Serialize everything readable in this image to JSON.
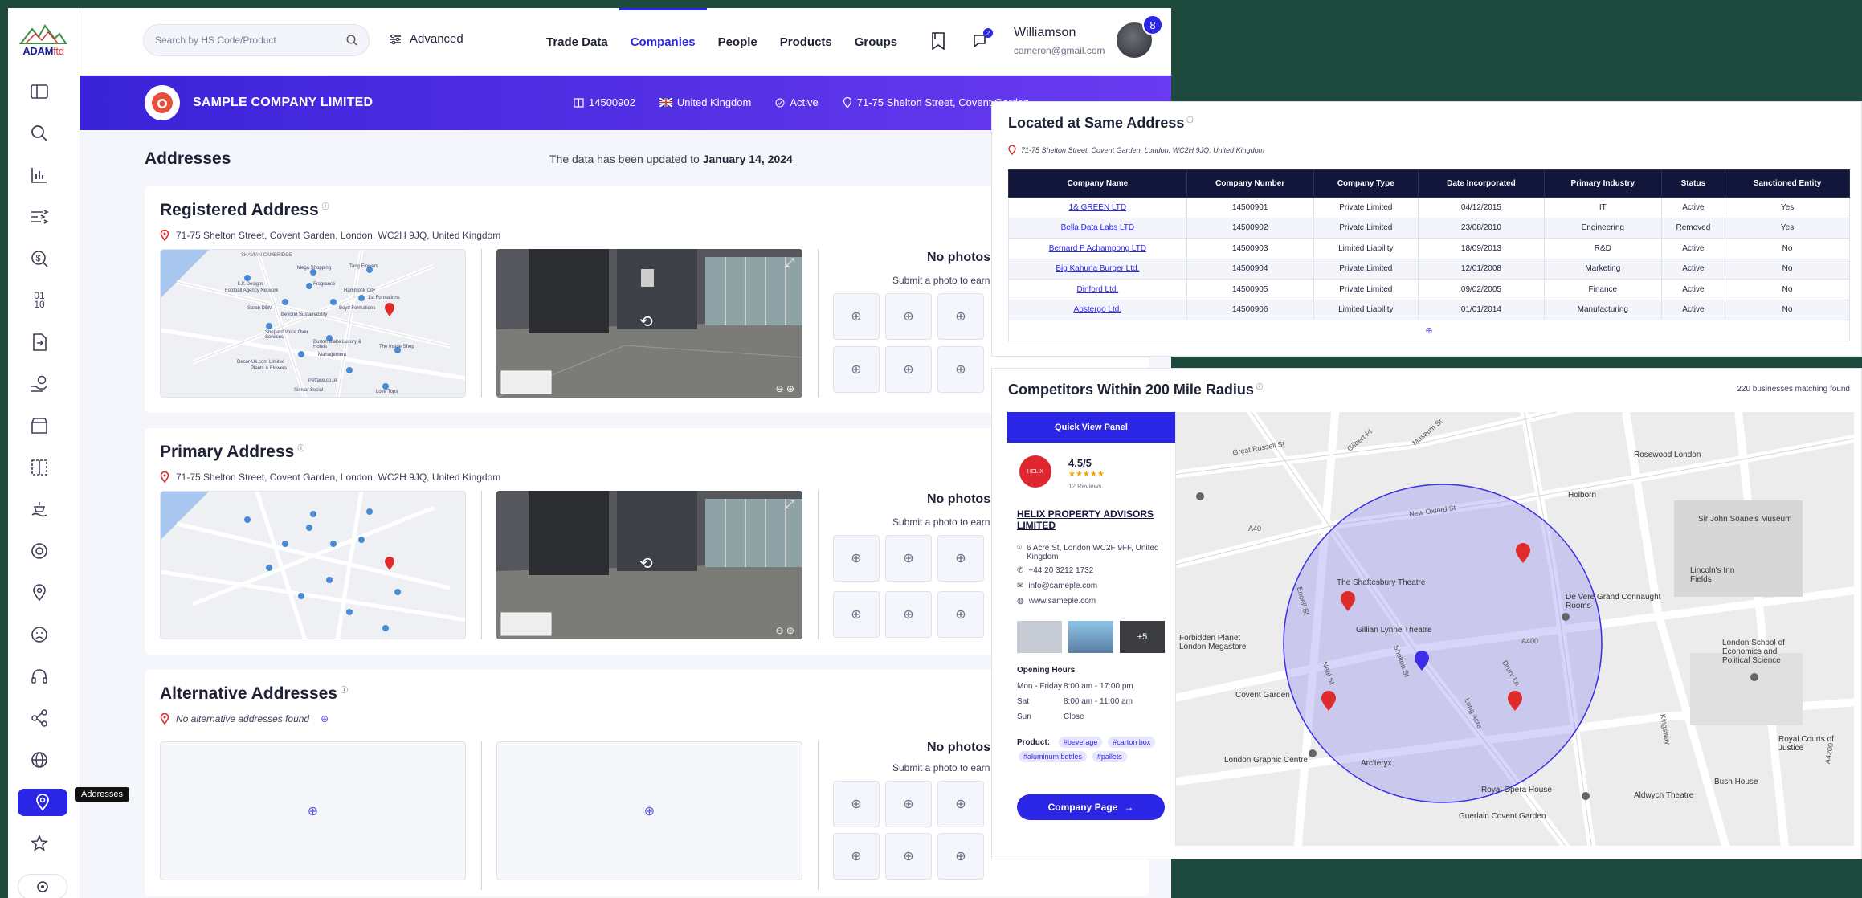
{
  "app": {
    "logo_text": "ADAM",
    "logo_suffix": "ftd",
    "search_placeholder": "Search by HS Code/Product",
    "advanced_label": "Advanced",
    "nav": [
      "Trade Data",
      "Companies",
      "People",
      "Products",
      "Groups"
    ],
    "active_nav": "Companies",
    "chat_badge": "2",
    "user": {
      "name": "Williamson",
      "email": "cameron@gmail.com",
      "badge": "8"
    },
    "sidebar_tooltip": "Addresses",
    "sidebar_icons": [
      "dashboard-icon",
      "search-icon",
      "bar-chart-icon",
      "sliders-icon",
      "dollar-search-icon",
      "binary-icon",
      "file-icon",
      "hand-coin-icon",
      "store-icon",
      "layout-icon",
      "shipping-icon",
      "radar-icon",
      "location-settings-icon",
      "sad-face-icon",
      "headset-icon",
      "share-icon",
      "globe-icon",
      "map-pin-icon",
      "star-icon",
      "settings-icon"
    ]
  },
  "banner": {
    "company_name": "SAMPLE COMPANY LIMITED",
    "company_number": "14500902",
    "country": "United Kingdom",
    "status": "Active",
    "address": "71-75 Shelton Street, Covent Garden"
  },
  "addresses": {
    "title": "Addresses",
    "updated_prefix": "The data has been updated to",
    "updated_date": "January 14, 2024",
    "registered": {
      "title": "Registered Address",
      "address": "71-75 Shelton Street, Covent Garden, London, WC2H 9JQ, United Kingdom"
    },
    "primary": {
      "title": "Primary Address",
      "address": "71-75 Shelton Street, Covent Garden, London, WC2H 9JQ, United Kingdom"
    },
    "alternative": {
      "title": "Alternative Addresses",
      "address": "No alternative addresses found"
    },
    "no_photos": "No photos",
    "submit_text": "Submit a photo to earn",
    "map_labels": [
      "SHAVIAN CAMBRIDGE",
      "Mega Shopping",
      "Tang Flowers",
      "L.K Designs",
      "Football Agency Network",
      "Fragrance",
      "Hammock City",
      "1st Formations",
      "Boyd Formations",
      "Sarah DBM",
      "Beyond Sustainability",
      "Shepard Voice Over Services",
      "Burton Blake Luxury & Hotels",
      "Management",
      "The Inside Shop",
      "Decor-Uk.com Limited",
      "Plants & Flowers",
      "Petface.co.uk",
      "Similar Social",
      "Love Tops"
    ]
  },
  "same_address": {
    "title": "Located at Same Address",
    "address": "71-75 Shelton Street, Covent Garden, London, WC2H 9JQ, United Kingdom",
    "columns": [
      "Company Name",
      "Company Number",
      "Company Type",
      "Date Incorporated",
      "Primary Industry",
      "Status",
      "Sanctioned Entity"
    ],
    "rows": [
      [
        "1& GREEN LTD",
        "14500901",
        "Private Limited",
        "04/12/2015",
        "IT",
        "Active",
        "Yes"
      ],
      [
        "Bella Data Labs LTD",
        "14500902",
        "Private Limited",
        "23/08/2010",
        "Engineering",
        "Removed",
        "Yes"
      ],
      [
        "Bernard P Achampong LTD",
        "14500903",
        "Limited Liability",
        "18/09/2013",
        "R&D",
        "Active",
        "No"
      ],
      [
        "Big Kahuna Burger Ltd.",
        "14500904",
        "Private Limited",
        "12/01/2008",
        "Marketing",
        "Active",
        "No"
      ],
      [
        "Dinford Ltd.",
        "14500905",
        "Private Limited",
        "09/02/2005",
        "Finance",
        "Active",
        "No"
      ],
      [
        "Abstergo Ltd.",
        "14500906",
        "Limited Liability",
        "01/01/2014",
        "Manufacturing",
        "Active",
        "No"
      ]
    ]
  },
  "competitors": {
    "title": "Competitors Within 200 Mile Radius",
    "count_text": "220 businesses matching found",
    "panel_header": "Quick View Panel",
    "rating": "4.5/5",
    "reviews": "12 Reviews",
    "company": "HELIX PROPERTY ADVISORS LIMITED",
    "logo_text": "HELIX",
    "address": "6 Acre St, London WC2F 9FF, United Kingdom",
    "phone": "+44 20 3212 1732",
    "email": "info@sameple.com",
    "website": "www.sameple.com",
    "more_photos": "+5",
    "hours_title": "Opening Hours",
    "hours": [
      [
        "Mon - Friday",
        "8:00 am - 17:00 pm"
      ],
      [
        "Sat",
        "8:00 am - 11:00 am"
      ],
      [
        "Sun",
        "Close"
      ]
    ],
    "product_label": "Product:",
    "products": [
      "#beverage",
      "#carton box",
      "#aluminum bottles",
      "#pallets"
    ],
    "button": "Company Page",
    "map_labels": [
      "Great Russell St",
      "Gilbert Pl",
      "Museum St",
      "Holborn",
      "Rosewood London",
      "Sir John Soane's Museum",
      "New Oxford St",
      "Lincoln's Inn Fields",
      "The Shaftesbury Theatre",
      "De Vere Grand Connaught Rooms",
      "Gillian Lynne Theatre",
      "London School of Economics and Political Science",
      "Forbidden Planet London Megastore",
      "Covent Garden",
      "Royal Courts of Justice",
      "Bush House",
      "Aldwych Theatre",
      "Royal Opera House",
      "Guerlain Covent Garden",
      "London Graphic Centre",
      "Arc'teryx",
      "Neal St",
      "Long Acre",
      "Kingsway",
      "Drury Ln",
      "Endell St",
      "Shelton St",
      "A40",
      "A400",
      "A4200"
    ]
  }
}
